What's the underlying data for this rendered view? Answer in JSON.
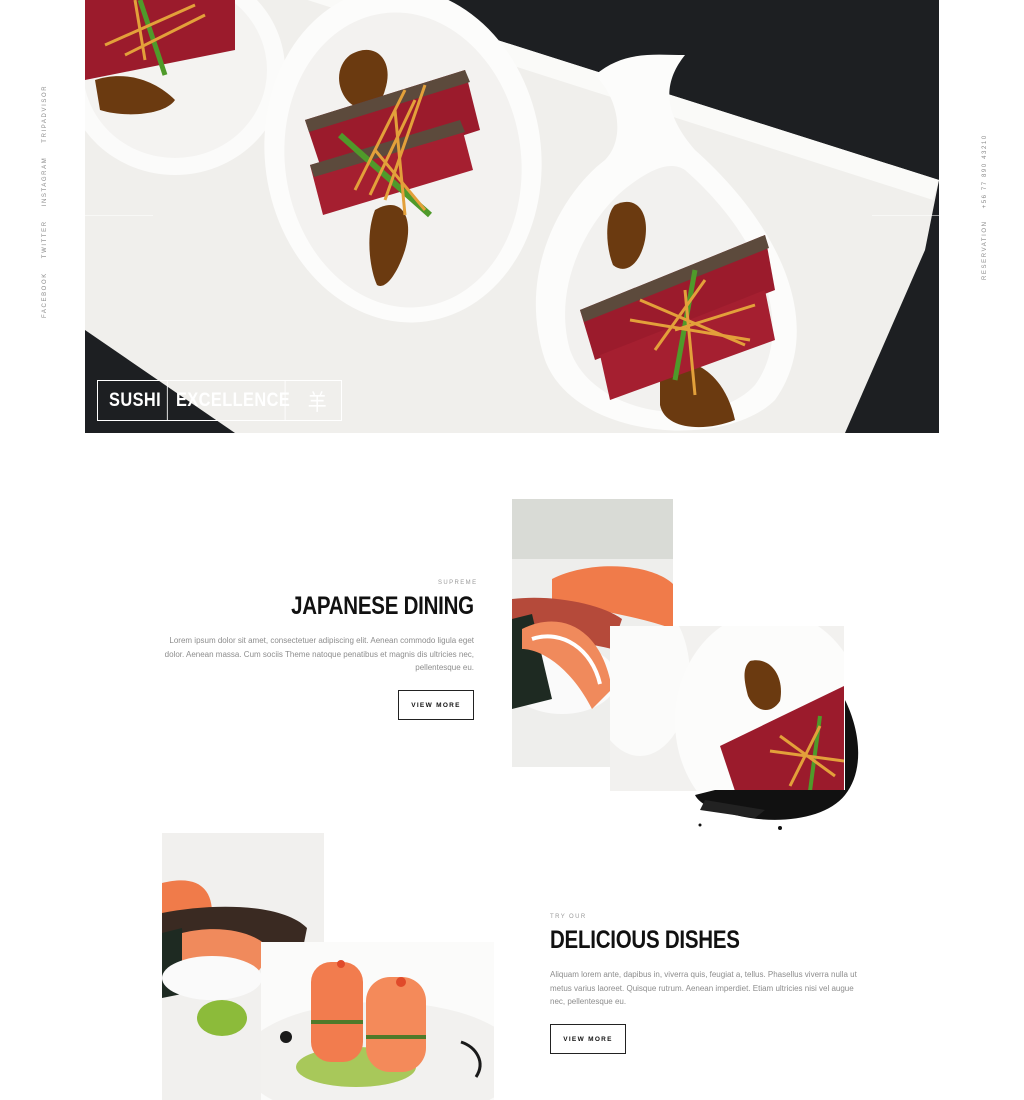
{
  "social": [
    "FACEBOOK",
    "TWITTER",
    "INSTAGRAM",
    "TRIPADVISOR"
  ],
  "right_rail": {
    "reservation": "RESERVATION",
    "phone": "+56 77 890 43210"
  },
  "hero": {
    "badge_sushi": "SUSHI",
    "badge_excellence": "EXCELLENCE",
    "badge_kanji": "羊"
  },
  "section1": {
    "kicker": "SUPREME",
    "title": "JAPANESE DINING",
    "paragraph": "Lorem ipsum dolor sit amet, consectetuer adipiscing elit. Aenean commodo ligula eget dolor. Aenean massa. Cum sociis Theme natoque penatibus et magnis dis ultricies nec, pellentesque eu.",
    "button": "VIEW MORE"
  },
  "section2": {
    "kicker": "TRY OUR",
    "title": "DELICIOUS DISHES",
    "paragraph": "Aliquam lorem ante, dapibus in, viverra quis, feugiat a, tellus. Phasellus viverra nulla ut metus varius laoreet. Quisque rutrum. Aenean imperdiet. Etiam ultricies nisi vel augue nec, pellentesque eu.",
    "button": "VIEW MORE"
  },
  "colors": {
    "hero_bg": "#1d1f22",
    "plate": "#f3f2ef",
    "tuna": "#9b1b2c",
    "sauce": "#6b3a10",
    "text": "#111111",
    "muted": "#8d8d8d"
  }
}
